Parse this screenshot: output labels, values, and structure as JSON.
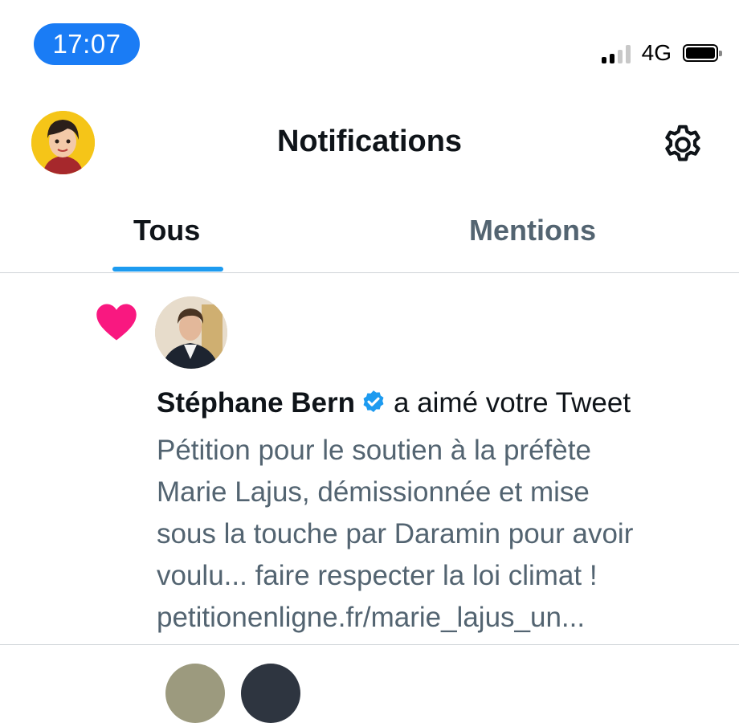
{
  "status_bar": {
    "time": "17:07",
    "network": "4G",
    "icons": [
      "signal-icon",
      "battery-icon"
    ]
  },
  "header": {
    "title": "Notifications",
    "icons": [
      "avatar",
      "gear-icon"
    ]
  },
  "tabs": [
    {
      "label": "Tous",
      "selected": true
    },
    {
      "label": "Mentions",
      "selected": false
    }
  ],
  "notification": {
    "icon": "heart-icon",
    "user_name": "Stéphane Bern",
    "verified": true,
    "action": "a aimé votre Tweet",
    "tweet_lines": [
      "Pétition pour le soutien à la préfète",
      "Marie Lajus, démissionnée et mise",
      "sous la touche par Daramin pour avoir",
      "voulu...  faire respecter la loi climat !",
      "petitionenligne.fr/marie_lajus_un..."
    ]
  },
  "colors": {
    "accent": "#1d9bf0",
    "time_pill": "#1a7cf5",
    "heart": "#f91880",
    "secondary_text": "#536471"
  }
}
